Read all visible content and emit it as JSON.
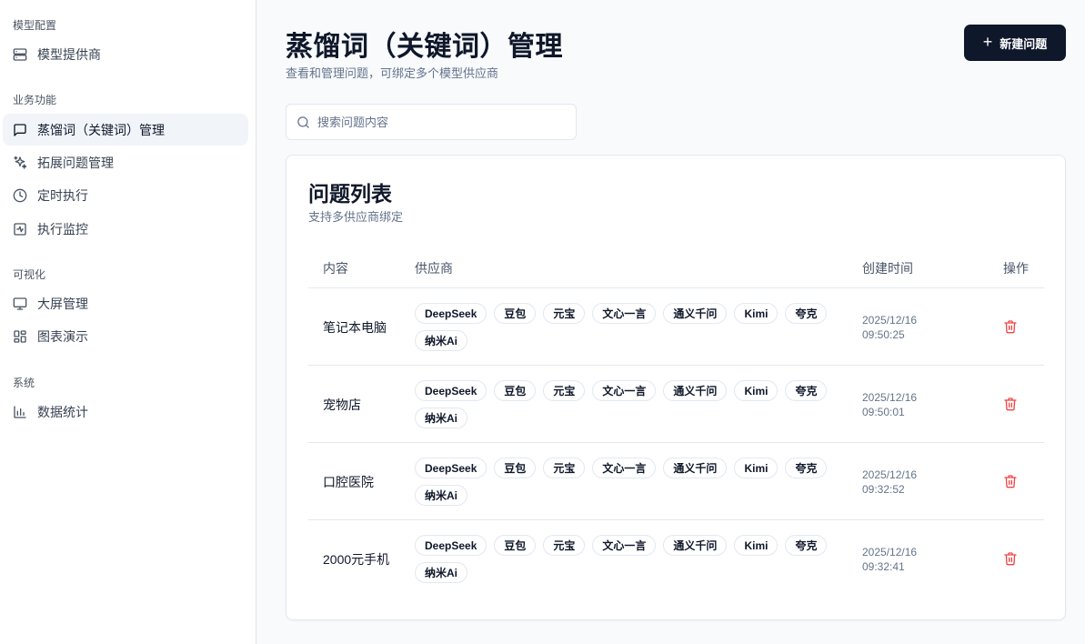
{
  "sidebar": {
    "groups": [
      {
        "title": "模型配置",
        "items": [
          {
            "label": "模型提供商",
            "icon": "server-icon"
          }
        ]
      },
      {
        "title": "业务功能",
        "items": [
          {
            "label": "蒸馏词（关键词）管理",
            "icon": "message-square-icon",
            "active": true
          },
          {
            "label": "拓展问题管理",
            "icon": "sparkles-icon"
          },
          {
            "label": "定时执行",
            "icon": "clock-icon"
          },
          {
            "label": "执行监控",
            "icon": "activity-icon"
          }
        ]
      },
      {
        "title": "可视化",
        "items": [
          {
            "label": "大屏管理",
            "icon": "monitor-icon"
          },
          {
            "label": "图表演示",
            "icon": "grid-icon"
          }
        ]
      },
      {
        "title": "系统",
        "items": [
          {
            "label": "数据统计",
            "icon": "bar-chart-icon"
          }
        ]
      }
    ]
  },
  "header": {
    "title": "蒸馏词（关键词）管理",
    "subtitle": "查看和管理问题，可绑定多个模型供应商",
    "new_button": "新建问题"
  },
  "search": {
    "placeholder": "搜索问题内容",
    "value": ""
  },
  "card": {
    "title": "问题列表",
    "subtitle": "支持多供应商绑定",
    "columns": [
      "内容",
      "供应商",
      "创建时间",
      "操作"
    ],
    "rows": [
      {
        "content": "笔记本电脑",
        "providers": [
          "DeepSeek",
          "豆包",
          "元宝",
          "文心一言",
          "通义千问",
          "Kimi",
          "夸克",
          "纳米Ai"
        ],
        "date": "2025/12/16",
        "time": "09:50:25"
      },
      {
        "content": "宠物店",
        "providers": [
          "DeepSeek",
          "豆包",
          "元宝",
          "文心一言",
          "通义千问",
          "Kimi",
          "夸克",
          "纳米Ai"
        ],
        "date": "2025/12/16",
        "time": "09:50:01"
      },
      {
        "content": "口腔医院",
        "providers": [
          "DeepSeek",
          "豆包",
          "元宝",
          "文心一言",
          "通义千问",
          "Kimi",
          "夸克",
          "纳米Ai"
        ],
        "date": "2025/12/16",
        "time": "09:32:52"
      },
      {
        "content": "2000元手机",
        "providers": [
          "DeepSeek",
          "豆包",
          "元宝",
          "文心一言",
          "通义千问",
          "Kimi",
          "夸克",
          "纳米Ai"
        ],
        "date": "2025/12/16",
        "time": "09:32:41"
      }
    ]
  },
  "colors": {
    "primary": "#0f172a",
    "danger": "#ef4444",
    "muted": "#64748b",
    "active_bg": "#f1f5f9"
  }
}
